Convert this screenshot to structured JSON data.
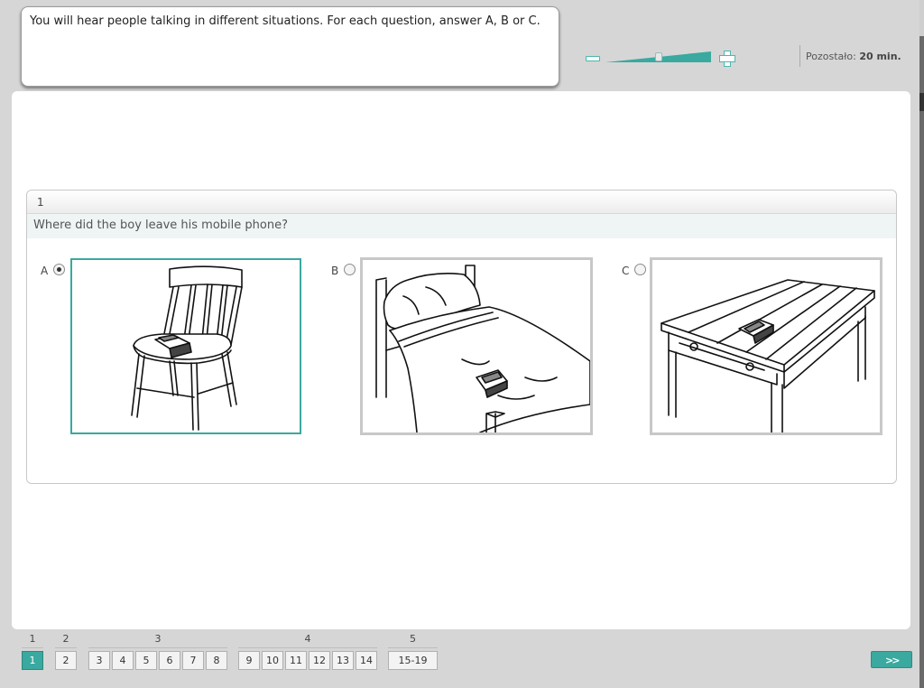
{
  "instruction": "You will hear people talking in different situations. For each question, answer A, B or C.",
  "zoom": {
    "level": 0.5
  },
  "timer": {
    "label": "Pozostało:",
    "value": "20 min."
  },
  "question": {
    "number": "1",
    "text": "Where did the boy leave his mobile phone?",
    "selected": "A",
    "options": [
      {
        "label": "A",
        "image_icon": "chair-with-phone-icon"
      },
      {
        "label": "B",
        "image_icon": "bed-with-phone-icon"
      },
      {
        "label": "C",
        "image_icon": "table-with-phone-icon"
      }
    ]
  },
  "colors": {
    "accent": "#3aa99f",
    "option_border": "#c8c8c8"
  },
  "navigation": {
    "groups": [
      {
        "label": "1",
        "items": [
          "1"
        ]
      },
      {
        "label": "2",
        "items": [
          "2"
        ]
      },
      {
        "label": "3",
        "items": [
          "3",
          "4",
          "5",
          "6",
          "7",
          "8"
        ]
      },
      {
        "label": "4",
        "items": [
          "9",
          "10",
          "11",
          "12",
          "13",
          "14"
        ]
      },
      {
        "label": "5",
        "items": [
          "15-19"
        ]
      }
    ],
    "current": "1",
    "next_icon": "double-chevron-right-icon"
  }
}
